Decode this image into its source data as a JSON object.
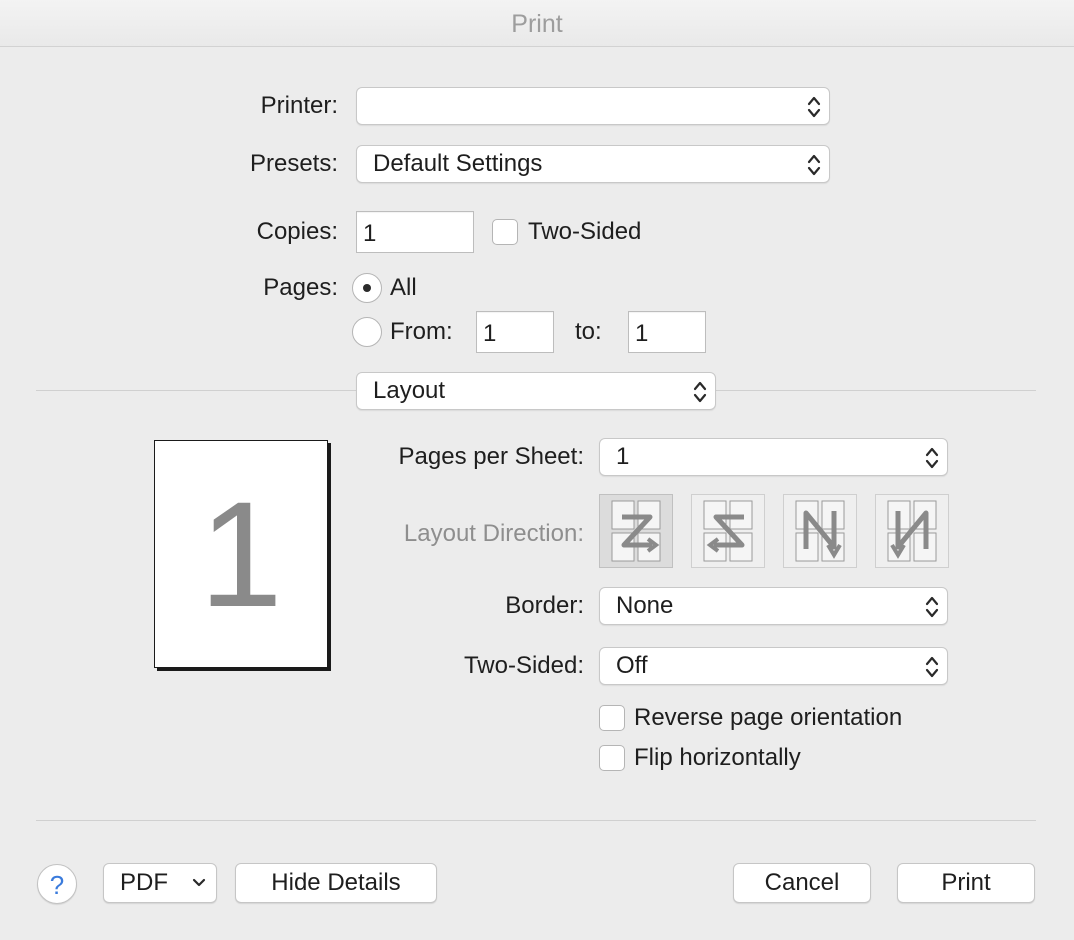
{
  "window": {
    "title": "Print"
  },
  "printer": {
    "label": "Printer:",
    "value": ""
  },
  "presets": {
    "label": "Presets:",
    "value": "Default Settings"
  },
  "copies": {
    "label": "Copies:",
    "value": "1",
    "two_sided_label": "Two-Sided",
    "two_sided_checked": false
  },
  "pages": {
    "label": "Pages:",
    "all_label": "All",
    "from_label": "From:",
    "to_label": "to:",
    "from_value": "1",
    "to_value": "1",
    "selected": "all"
  },
  "section": {
    "value": "Layout"
  },
  "preview": {
    "page_number": "1"
  },
  "layout": {
    "pages_per_sheet_label": "Pages per Sheet:",
    "pages_per_sheet_value": "1",
    "direction_label": "Layout Direction:",
    "directions": [
      "z-left-right",
      "z-right-left",
      "n-top-bottom",
      "n-top-bottom-reverse"
    ],
    "selected_direction": 0,
    "border_label": "Border:",
    "border_value": "None",
    "two_sided_label": "Two-Sided:",
    "two_sided_value": "Off",
    "reverse_label": "Reverse page orientation",
    "flip_label": "Flip horizontally"
  },
  "footer": {
    "help": "?",
    "pdf": "PDF",
    "hide_details": "Hide Details",
    "cancel": "Cancel",
    "print": "Print"
  }
}
